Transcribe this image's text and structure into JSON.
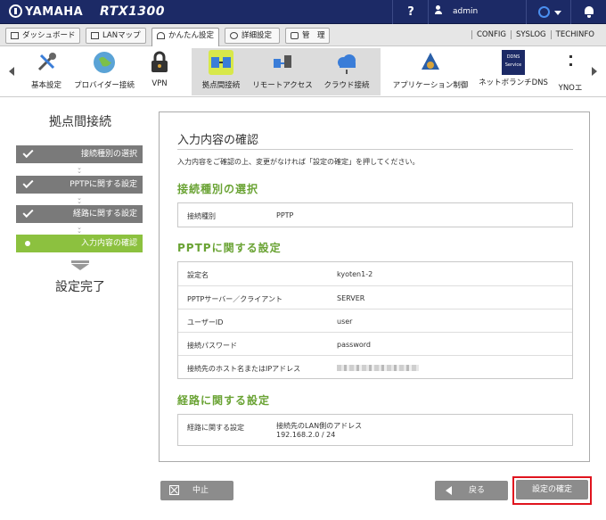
{
  "header": {
    "brand": "YAMAHA",
    "model": "RTX1300",
    "help": "?",
    "user": "admin"
  },
  "menu": {
    "tabs": [
      {
        "label": "ダッシュボード"
      },
      {
        "label": "LANマップ"
      },
      {
        "label": "かんたん設定"
      },
      {
        "label": "詳細設定"
      },
      {
        "label": "管　理"
      }
    ],
    "links": [
      "CONFIG",
      "SYSLOG",
      "TECHINFO"
    ]
  },
  "strip": {
    "items": [
      {
        "label": "基本設定"
      },
      {
        "label": "プロバイダー接続"
      },
      {
        "label": "VPN"
      },
      {
        "label": "拠点間接続"
      },
      {
        "label": "リモートアクセス"
      },
      {
        "label": "クラウド接続"
      },
      {
        "label": "アプリケーション制御"
      },
      {
        "label": "ネットボランチDNS"
      },
      {
        "label": "YNOエ"
      }
    ],
    "ddns_badge": "DDNS Service"
  },
  "wizard": {
    "title": "拠点間接続",
    "steps": [
      {
        "label": "接続種別の選択"
      },
      {
        "label": "PPTPに関する設定"
      },
      {
        "label": "経路に関する設定"
      },
      {
        "label": "入力内容の確認"
      }
    ],
    "finish": "設定完了"
  },
  "panel": {
    "title": "入力内容の確認",
    "description": "入力内容をご確認の上、変更がなければ「設定の確定」を押してください。",
    "sections": [
      {
        "heading": "接続種別の選択",
        "rows": [
          {
            "key": "接続種別",
            "value": "PPTP"
          }
        ]
      },
      {
        "heading": "PPTPに関する設定",
        "rows": [
          {
            "key": "設定名",
            "value": "kyoten1-2"
          },
          {
            "key": "PPTPサーバー／クライアント",
            "value": "SERVER"
          },
          {
            "key": "ユーザーID",
            "value": "user"
          },
          {
            "key": "接続パスワード",
            "value": "password"
          },
          {
            "key": "接続先のホスト名またはIPアドレス",
            "value": ""
          }
        ]
      },
      {
        "heading": "経路に関する設定",
        "rows": [
          {
            "key": "経路に関する設定",
            "value": "接続先のLAN側のアドレス",
            "value2": "192.168.2.0 / 24"
          }
        ]
      }
    ]
  },
  "buttons": {
    "cancel": "中止",
    "back": "戻る",
    "confirm": "設定の確定"
  },
  "colors": {
    "header_bg": "#1c2a66",
    "accent_green": "#8cc13f",
    "section_green": "#6aa334",
    "highlight_red": "#e0141e"
  }
}
